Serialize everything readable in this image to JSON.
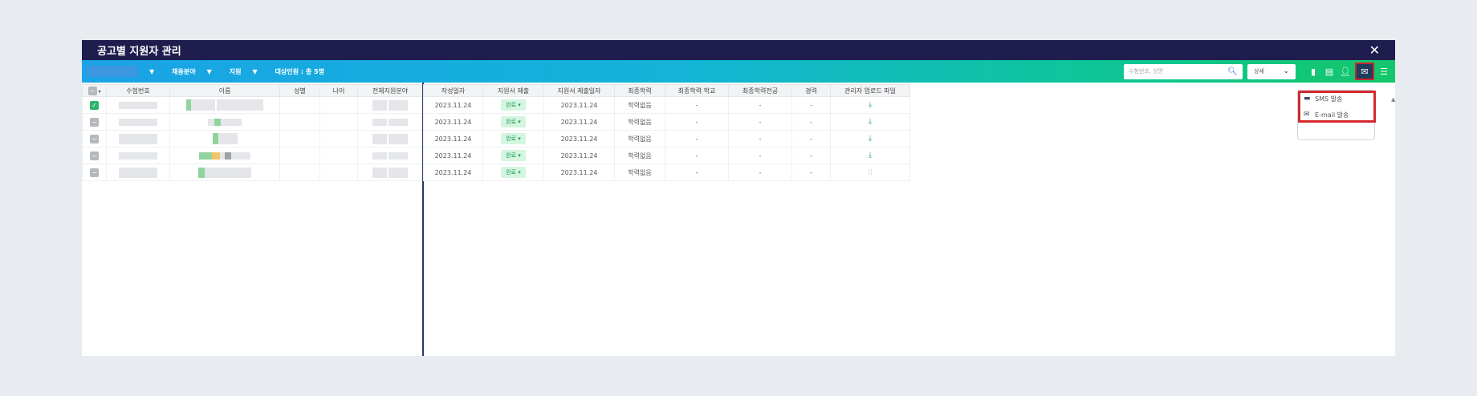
{
  "window": {
    "title": "공고별 지원자 관리",
    "close_icon": "close-icon"
  },
  "toolbar": {
    "filters": [
      {
        "label": "채용분야"
      },
      {
        "label": "지원"
      }
    ],
    "count_label": "대상인원 : 총 5명",
    "search_placeholder": "수험번호, 성명",
    "select_value": "상세",
    "icons": [
      "document-icon",
      "document-edit-icon",
      "user-edit-icon",
      "mail-icon",
      "list-icon"
    ]
  },
  "left_table": {
    "headers": [
      "수험번호",
      "이름",
      "성별",
      "나이",
      "전체지원분야"
    ],
    "rows": [
      {
        "checked": true
      },
      {
        "checked": false
      },
      {
        "checked": false
      },
      {
        "checked": false
      },
      {
        "checked": false
      }
    ]
  },
  "right_table": {
    "headers": [
      "작성일자",
      "지원서 제출",
      "지원서 제출일자",
      "최종학력",
      "최종학력 학교",
      "최종학력전공",
      "경력",
      "관리자 업로드 파일"
    ],
    "rows": [
      {
        "created": "2023.11.24",
        "status": "완료 ▾",
        "submitted": "2023.11.24",
        "education": "학력없음",
        "school": "-",
        "major": "-",
        "career": "-",
        "file": true
      },
      {
        "created": "2023.11.24",
        "status": "완료 ▾",
        "submitted": "2023.11.24",
        "education": "학력없음",
        "school": "-",
        "major": "-",
        "career": "-",
        "file": true
      },
      {
        "created": "2023.11.24",
        "status": "완료 ▾",
        "submitted": "2023.11.24",
        "education": "학력없음",
        "school": "-",
        "major": "-",
        "career": "-",
        "file": true
      },
      {
        "created": "2023.11.24",
        "status": "완료 ▾",
        "submitted": "2023.11.24",
        "education": "학력없음",
        "school": "-",
        "major": "-",
        "career": "-",
        "file": true
      },
      {
        "created": "2023.11.24",
        "status": "완료 ▾",
        "submitted": "2023.11.24",
        "education": "학력없음",
        "school": "-",
        "major": "-",
        "career": "-",
        "file": false
      }
    ]
  },
  "dropdown": {
    "items": [
      {
        "label": "SMS 발송",
        "icon": "chat-icon"
      },
      {
        "label": "E-mail 발송",
        "icon": "mail-icon"
      }
    ]
  },
  "colors": {
    "title_bg": "#1f1d4e",
    "highlight": "#d42a2f",
    "accent_green": "#2db46c"
  }
}
